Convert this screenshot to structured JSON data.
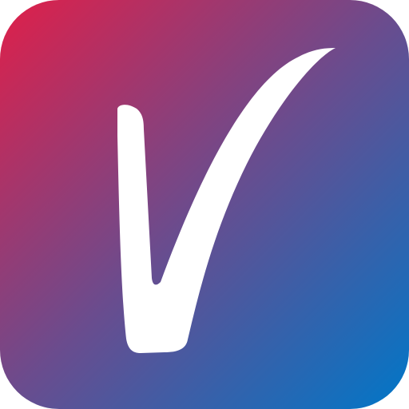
{
  "app_icon": {
    "icon": "check-v-icon",
    "colors": {
      "gradient_start": "#E01F49",
      "gradient_middle": "#6A4C8E",
      "gradient_end": "#0077C8",
      "glyph": "#FFFFFF"
    }
  }
}
